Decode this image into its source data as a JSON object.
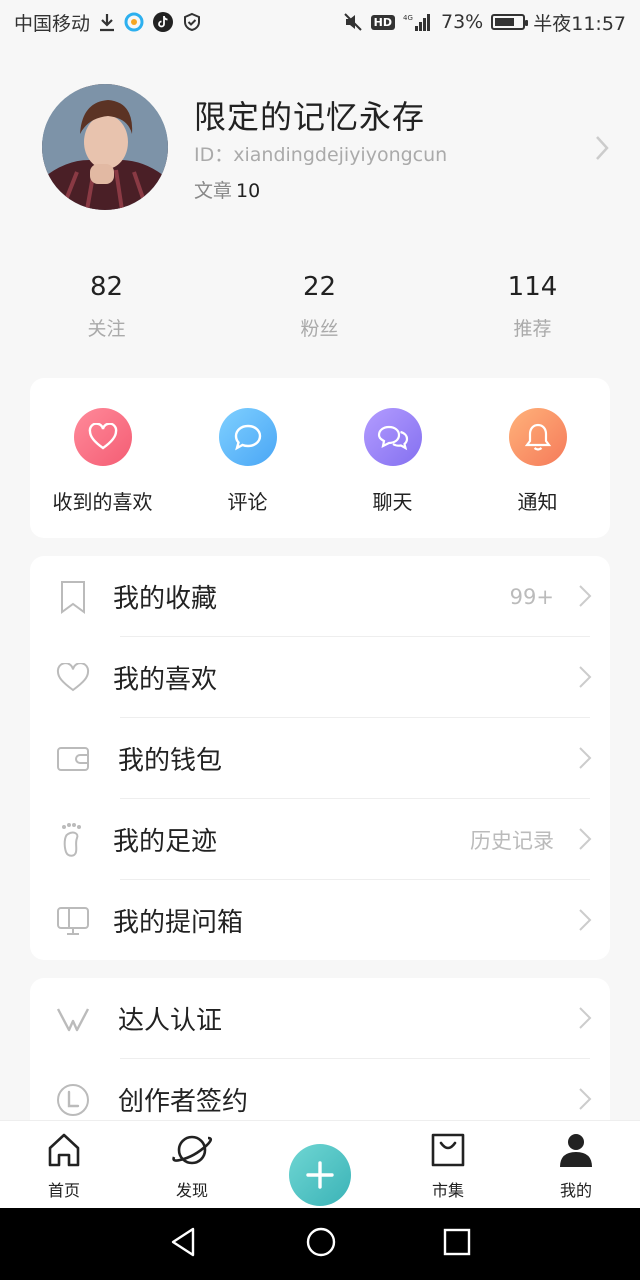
{
  "status_bar": {
    "carrier": "中国移动",
    "hd": "HD",
    "network": "4G",
    "battery": "73%",
    "battery_level": 0.73,
    "time": "半夜11:57"
  },
  "profile": {
    "name": "限定的记忆永存",
    "id_text": "ID：xiandingdejiyiyongcun",
    "articles_label": "文章",
    "articles_count": "10"
  },
  "stats": [
    {
      "value": "82",
      "label": "关注"
    },
    {
      "value": "22",
      "label": "粉丝"
    },
    {
      "value": "114",
      "label": "推荐"
    }
  ],
  "quick_actions": [
    {
      "label": "收到的喜欢",
      "icon": "heart-icon",
      "color_from": "#ff8a9a",
      "color_to": "#f45d74"
    },
    {
      "label": "评论",
      "icon": "comment-icon",
      "color_from": "#7fd0ff",
      "color_to": "#4aa6f5"
    },
    {
      "label": "聊天",
      "icon": "chat-icon",
      "color_from": "#b39cff",
      "color_to": "#8470f0"
    },
    {
      "label": "通知",
      "icon": "bell-icon",
      "color_from": "#ffb27a",
      "color_to": "#f57a5a"
    }
  ],
  "menu": [
    {
      "label": "我的收藏",
      "value": "99+",
      "icon": "bookmark-icon"
    },
    {
      "label": "我的喜欢",
      "value": "",
      "icon": "heart-outline-icon"
    },
    {
      "label": "我的钱包",
      "value": "",
      "icon": "wallet-icon"
    },
    {
      "label": "我的足迹",
      "value": "历史记录",
      "icon": "footprint-icon"
    },
    {
      "label": "我的提问箱",
      "value": "",
      "icon": "question-box-icon"
    }
  ],
  "menu2": [
    {
      "label": "达人认证",
      "icon": "verified-v-icon"
    },
    {
      "label": "创作者签约",
      "icon": "contract-icon"
    }
  ],
  "bottom_nav": [
    {
      "label": "首页",
      "icon": "home-icon"
    },
    {
      "label": "发现",
      "icon": "planet-icon"
    },
    {
      "label": "",
      "icon": "add-icon"
    },
    {
      "label": "市集",
      "icon": "shopping-bag-icon"
    },
    {
      "label": "我的",
      "icon": "person-icon"
    }
  ],
  "colors": {
    "accent": "#3bb3b7",
    "background": "#f7f7f7"
  }
}
